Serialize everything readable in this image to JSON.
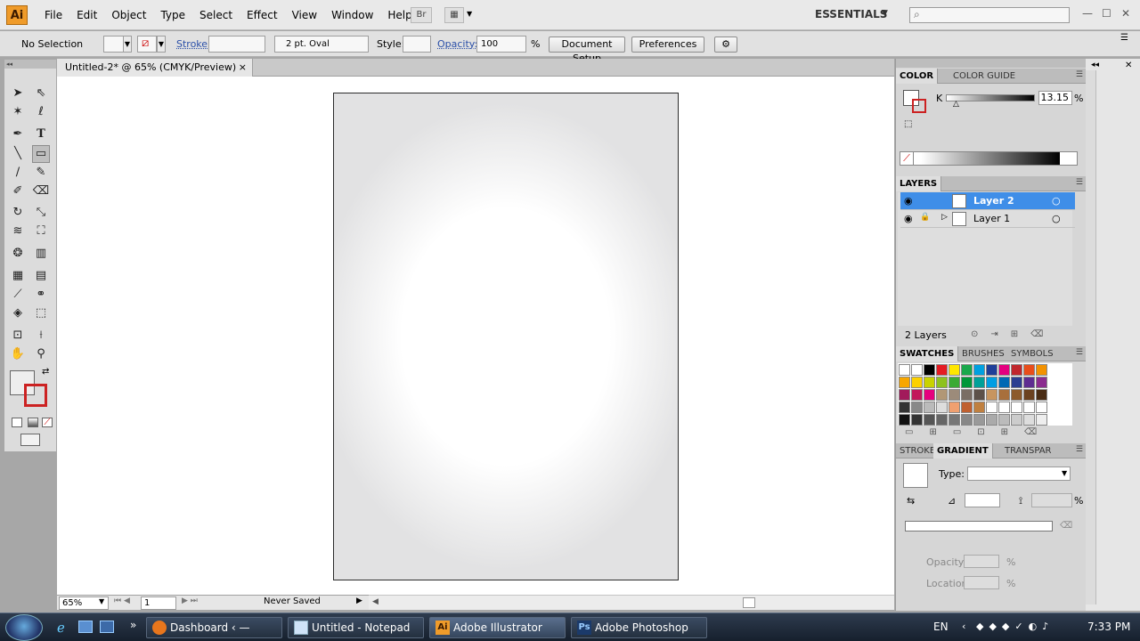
{
  "app": {
    "logo": "Ai"
  },
  "menu": [
    "File",
    "Edit",
    "Object",
    "Type",
    "Select",
    "Effect",
    "View",
    "Window",
    "Help"
  ],
  "menubar": {
    "bridge_label": "Br",
    "workspace": "ESSENTIALS"
  },
  "control": {
    "selection": "No Selection",
    "stroke_label": "Stroke:",
    "brush": "2 pt. Oval",
    "style_label": "Style:",
    "opacity_label": "Opacity:",
    "opacity_value": "100",
    "percent": "%",
    "document_setup": "Document Setup",
    "preferences": "Preferences"
  },
  "document": {
    "tab_title": "Untitled-2* @ 65% (CMYK/Preview)",
    "close": "×"
  },
  "status": {
    "zoom": "65%",
    "page": "1",
    "save_state": "Never Saved"
  },
  "color_panel": {
    "tabs": [
      "COLOR",
      "COLOR GUIDE"
    ],
    "channel": "K",
    "value": "13.15",
    "percent": "%"
  },
  "layers_panel": {
    "title": "LAYERS",
    "layers": [
      {
        "name": "Layer 2",
        "selected": true
      },
      {
        "name": "Layer 1",
        "selected": false
      }
    ],
    "count": "2 Layers"
  },
  "swatches_panel": {
    "tabs": [
      "SWATCHES",
      "BRUSHES",
      "SYMBOLS"
    ]
  },
  "gradient_panel": {
    "tabs": [
      "STROKE",
      "GRADIENT",
      "TRANSPAR"
    ],
    "type_label": "Type:",
    "percent": "%",
    "opacity_label": "Opacity:",
    "location_label": "Location:"
  },
  "taskbar": {
    "tasks": [
      {
        "label": "Dashboard ‹ — Wor...",
        "icon": "firefox-icon"
      },
      {
        "label": "Untitled - Notepad",
        "icon": "notepad-icon"
      },
      {
        "label": "Adobe Illustrator CS...",
        "icon": "illustrator-icon"
      },
      {
        "label": "Adobe Photoshop C...",
        "icon": "photoshop-icon"
      }
    ],
    "lang": "EN",
    "time": "7:33 PM"
  },
  "colors": {
    "accent": "#3f8ee8",
    "ai_orange": "#ef9b2a",
    "taskbar": "#1f2a38"
  }
}
